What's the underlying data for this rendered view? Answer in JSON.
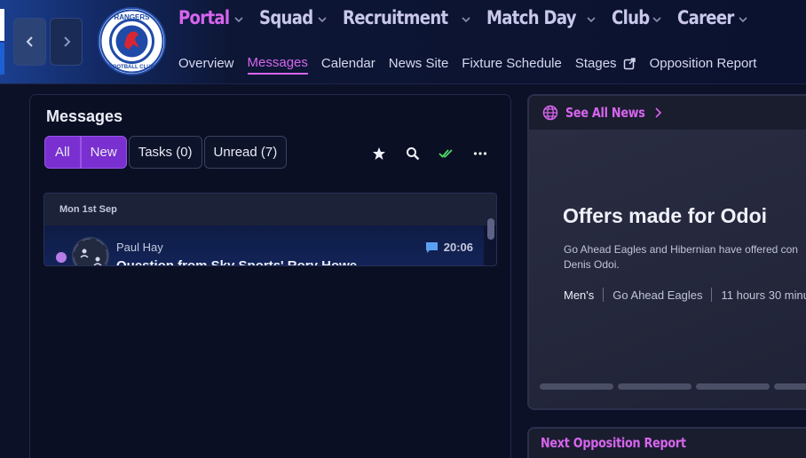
{
  "header": {
    "nav": [
      {
        "label": "Portal",
        "active": true
      },
      {
        "label": "Squad",
        "active": false
      },
      {
        "label": "Recruitment",
        "active": false
      },
      {
        "label": "Match Day",
        "active": false
      },
      {
        "label": "Club",
        "active": false
      },
      {
        "label": "Career",
        "active": false
      }
    ],
    "sub": [
      {
        "label": "Overview",
        "active": false
      },
      {
        "label": "Messages",
        "active": true
      },
      {
        "label": "Calendar",
        "active": false
      },
      {
        "label": "News Site",
        "active": false
      },
      {
        "label": "Fixture Schedule",
        "active": false
      },
      {
        "label": "Stages",
        "active": false
      },
      {
        "label": "Opposition Report",
        "active": false
      }
    ],
    "crest_text": {
      "top": "RANGERS",
      "bottom": "FOOTBALL CLUB",
      "ready": "READY"
    }
  },
  "messages": {
    "title": "Messages",
    "filters": {
      "all": "All",
      "new": "New",
      "tasks": "Tasks (0)",
      "unread": "Unread (7)"
    },
    "group_date": "Mon 1st Sep",
    "items": [
      {
        "sender": "Paul Hay",
        "subject": "Question from Sky Sports' Rory Howe",
        "time": "20:06",
        "unread": true
      }
    ]
  },
  "news": {
    "header": "See All News",
    "title": "Offers made for Odoi",
    "description": "Go Ahead Eagles and Hibernian have offered con Denis Odoi.",
    "meta": [
      "Men's",
      "Go Ahead Eagles",
      "11 hours 30 minut..."
    ]
  },
  "opposition": {
    "header": "Next Opposition Report"
  },
  "colors": {
    "accent": "#d765ee",
    "selected": "#7a2fd0",
    "check": "#4cd964"
  }
}
